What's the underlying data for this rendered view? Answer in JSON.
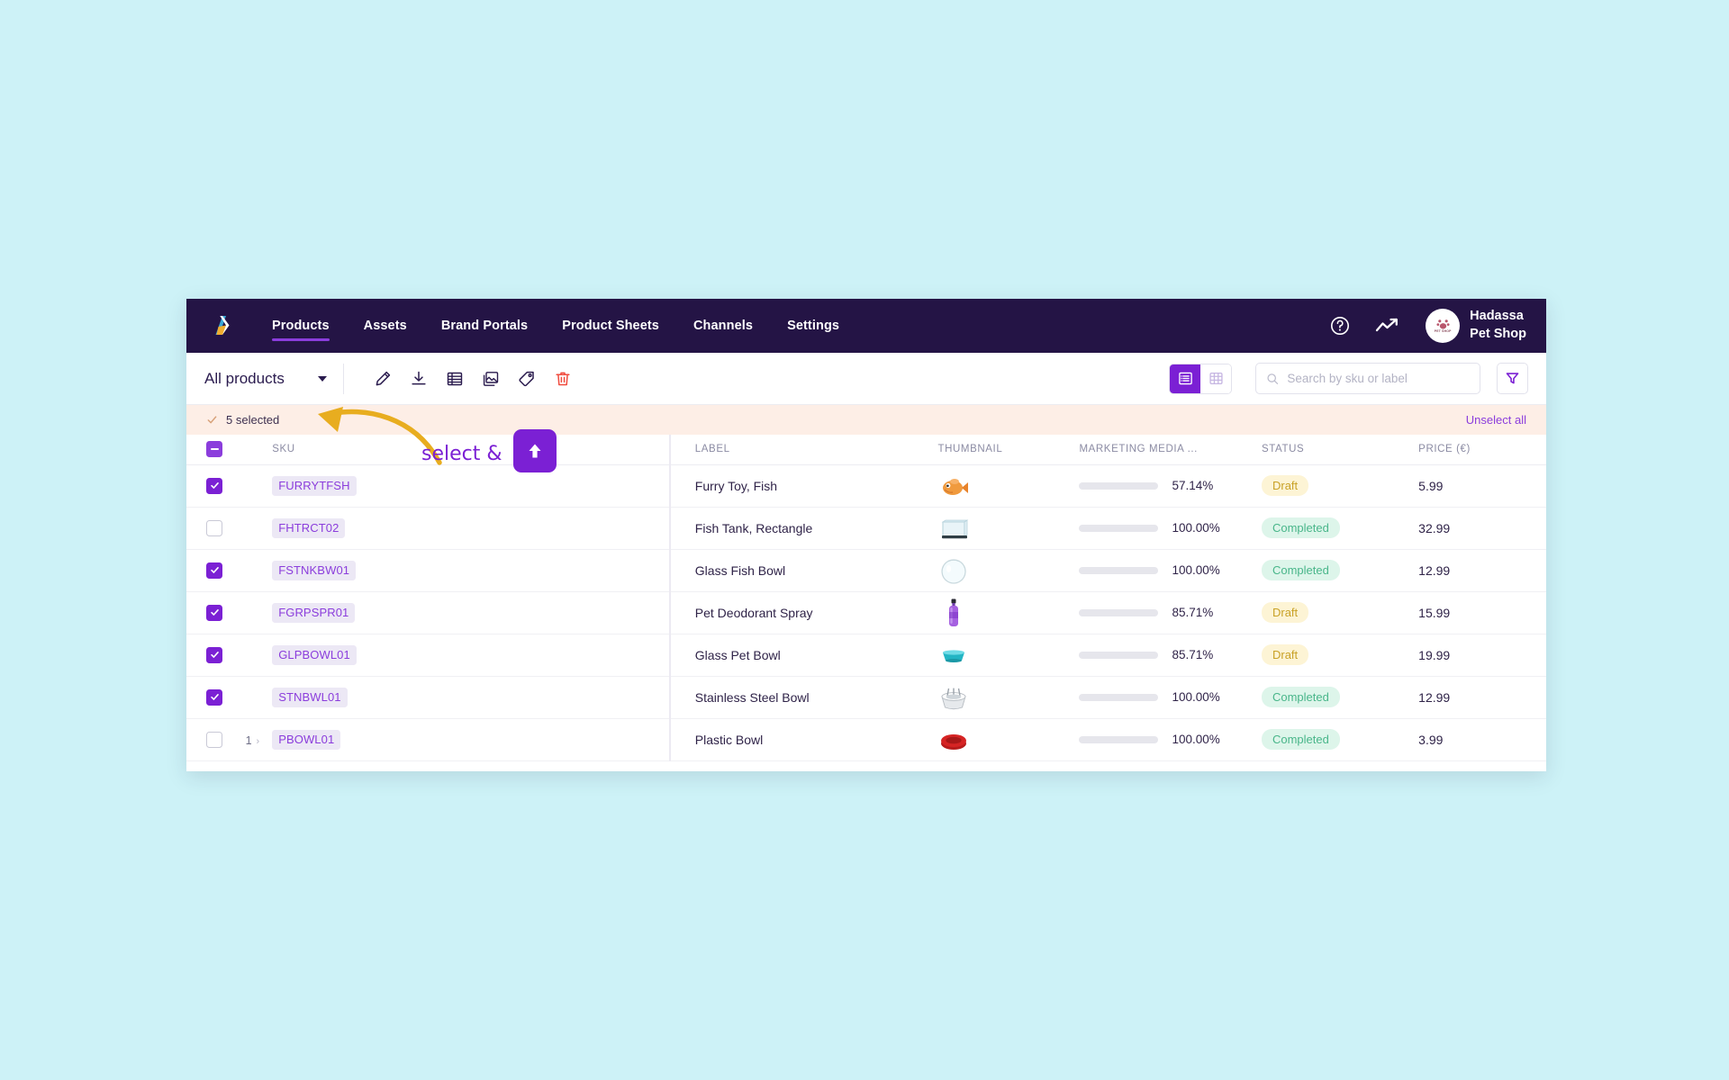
{
  "nav": {
    "logo_icon": "app-logo-icon",
    "links": [
      {
        "label": "Products",
        "active": true
      },
      {
        "label": "Assets",
        "active": false
      },
      {
        "label": "Brand Portals",
        "active": false
      },
      {
        "label": "Product Sheets",
        "active": false
      },
      {
        "label": "Channels",
        "active": false
      },
      {
        "label": "Settings",
        "active": false
      }
    ],
    "help_icon": "question-circle-icon",
    "analytics_icon": "trend-line-icon",
    "avatar_icon": "pet-shop-avatar",
    "avatar_text": "PET SHOP",
    "user_name": "Hadassa\nPet Shop"
  },
  "toolbar": {
    "view_selector_label": "All products",
    "caret_icon": "chevron-down-icon",
    "actions": [
      {
        "name": "edit-button",
        "icon": "pencil-icon"
      },
      {
        "name": "download-button",
        "icon": "download-icon"
      },
      {
        "name": "list-attributes-button",
        "icon": "table-rows-icon"
      },
      {
        "name": "media-button",
        "icon": "images-icon"
      },
      {
        "name": "tag-button",
        "icon": "tag-icon"
      },
      {
        "name": "delete-button",
        "icon": "trash-icon"
      }
    ],
    "view_toggle": {
      "list_icon": "list-view-icon",
      "grid_icon": "grid-view-icon",
      "active": "list"
    },
    "search_placeholder": "Search by sku or label",
    "search_value": "",
    "search_icon": "search-icon",
    "filter_icon": "filter-funnel-icon"
  },
  "selection_bar": {
    "check_icon": "check-icon",
    "count_label": "5 selected",
    "unselect_label": "Unselect all"
  },
  "table": {
    "headers": {
      "sku": "SKU",
      "label": "LABEL",
      "thumbnail": "THUMBNAIL",
      "media": "MARKETING MEDIA ...",
      "status": "STATUS",
      "price": "PRICE (€)"
    },
    "header_checkbox_state": "indeterminate",
    "rows": [
      {
        "selected": true,
        "expand": "",
        "sku": "FURRYTFSH",
        "label": "Furry Toy, Fish",
        "thumb": "furry-fish-toy",
        "media_pct": "57.14%",
        "media_value": 57.14,
        "media_color": "#f5d210",
        "status": "Draft",
        "status_type": "draft",
        "price": "5.99"
      },
      {
        "selected": false,
        "expand": "",
        "sku": "FHTRCT02",
        "label": "Fish Tank, Rectangle",
        "thumb": "fish-tank-rectangle",
        "media_pct": "100.00%",
        "media_value": 100,
        "media_color": "#58ccA0",
        "status": "Completed",
        "status_type": "completed",
        "price": "32.99"
      },
      {
        "selected": true,
        "expand": "",
        "sku": "FSTNKBW01",
        "label": "Glass Fish Bowl",
        "thumb": "glass-fish-bowl",
        "media_pct": "100.00%",
        "media_value": 100,
        "media_color": "#58ccA0",
        "status": "Completed",
        "status_type": "completed",
        "price": "12.99"
      },
      {
        "selected": true,
        "expand": "",
        "sku": "FGRPSPR01",
        "label": "Pet Deodorant Spray",
        "thumb": "deodorant-spray-bottle",
        "media_pct": "85.71%",
        "media_value": 85.71,
        "media_color": "#f5d210",
        "status": "Draft",
        "status_type": "draft",
        "price": "15.99"
      },
      {
        "selected": true,
        "expand": "",
        "sku": "GLPBOWL01",
        "label": "Glass Pet Bowl",
        "thumb": "teal-glass-bowl",
        "media_pct": "85.71%",
        "media_value": 85.71,
        "media_color": "#f5d210",
        "status": "Draft",
        "status_type": "draft",
        "price": "19.99"
      },
      {
        "selected": true,
        "expand": "",
        "sku": "STNBWL01",
        "label": "Stainless Steel Bowl",
        "thumb": "stainless-steel-bowl",
        "media_pct": "100.00%",
        "media_value": 100,
        "media_color": "#58ccA0",
        "status": "Completed",
        "status_type": "completed",
        "price": "12.99"
      },
      {
        "selected": false,
        "expand": "1",
        "sku": "PBOWL01",
        "label": "Plastic Bowl",
        "thumb": "red-plastic-bowl",
        "media_pct": "100.00%",
        "media_value": 100,
        "media_color": "#58ccA0",
        "status": "Completed",
        "status_type": "completed",
        "price": "3.99"
      }
    ]
  },
  "annotation": {
    "text": "select &",
    "arrow_icon": "curved-arrow-left-icon",
    "upload_icon": "upload-arrow-icon",
    "arrow_color": "#e8ad1f",
    "accent_color": "#7b20d4"
  }
}
